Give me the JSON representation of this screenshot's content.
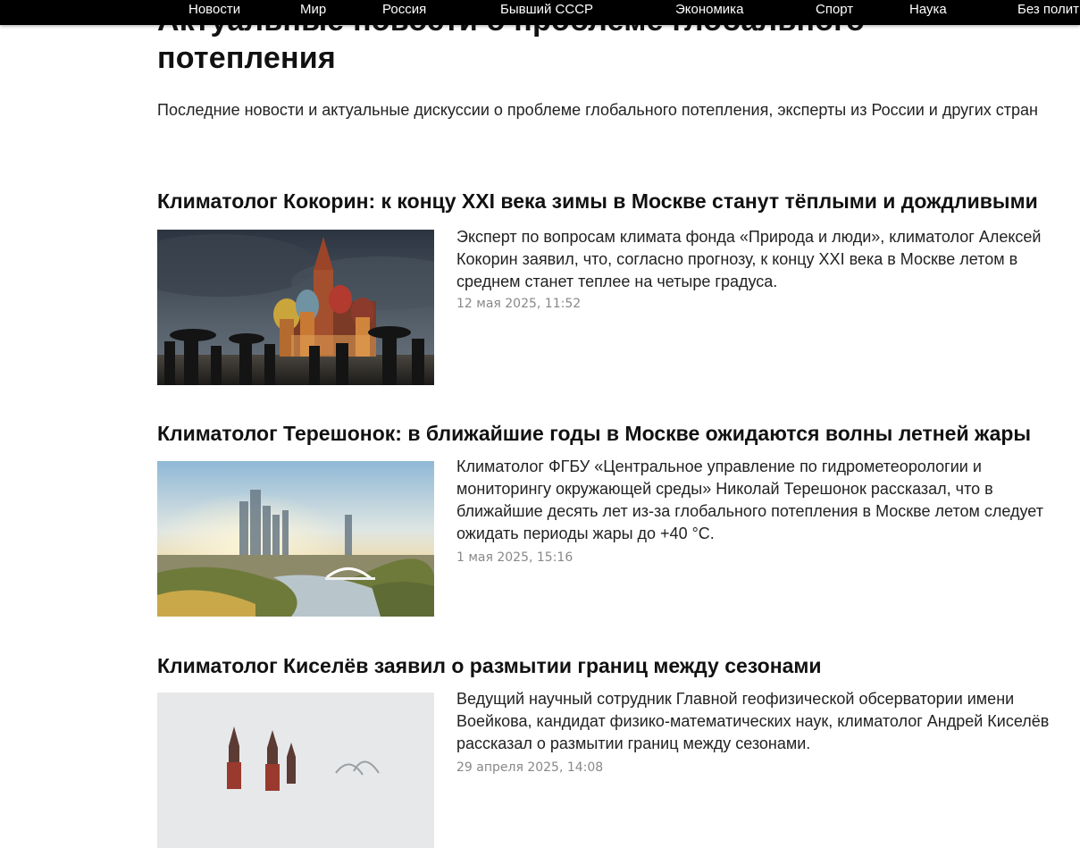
{
  "nav": {
    "items": [
      {
        "label": "Новости"
      },
      {
        "label": "Мир"
      },
      {
        "label": "Россия"
      },
      {
        "label": "Бывший СССР"
      },
      {
        "label": "Экономика"
      },
      {
        "label": "Спорт"
      },
      {
        "label": "Наука"
      },
      {
        "label": "Без полит"
      }
    ]
  },
  "page": {
    "title_line1": "Актуальные новости о проблеме глобального",
    "title_line2": "потепления",
    "subtitle": "Последние новости и актуальные дискуссии о проблеме глобального потепления, эксперты из России и других стран"
  },
  "articles": [
    {
      "title": "Климатолог Кокорин: к концу XXI века зимы в Москве станут тёплыми и дождливыми",
      "text": "Эксперт по вопросам климата фонда «Природа и люди», климатолог Алексей Кокорин заявил, что, согласно прогнозу, к концу XXI века в Москве летом в среднем станет теплее на четыре градуса.",
      "date": "12 мая 2025, 11:52"
    },
    {
      "title": "Климатолог Терешонок: в ближайшие годы в Москве ожидаются волны летней жары",
      "text": "Климатолог ФГБУ «Центральное управление по гидрометеорологии и мониторингу окружающей среды» Николай Терешонок рассказал, что в ближайшие десять лет из-за глобального потепления в Москве летом следует ожидать периоды жары до +40 °C.",
      "date": "1 мая 2025, 15:16"
    },
    {
      "title": "Климатолог Киселёв заявил о размытии границ между сезонами",
      "text": "Ведущий научный сотрудник Главной геофизической обсерватории имени Воейкова, кандидат физико-математических наук, климатолог Андрей Киселёв рассказал о размытии границ между сезонами.",
      "date": "29 апреля 2025, 14:08"
    }
  ],
  "colors": {
    "nav_background": "#000000",
    "nav_text": "#ffffff",
    "title": "#111111",
    "date": "#888888"
  }
}
